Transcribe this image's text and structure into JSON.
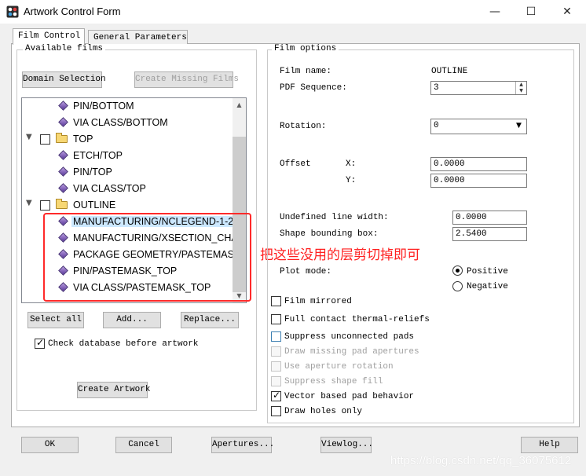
{
  "window": {
    "title": "Artwork Control Form",
    "minimize": "—",
    "maximize": "☐",
    "close": "✕"
  },
  "tabs": [
    {
      "label": "Film Control"
    },
    {
      "label": "General Parameters"
    }
  ],
  "available_films": {
    "label": "Available films",
    "domain_selection": "Domain Selection",
    "create_missing": "Create Missing Films",
    "tree": [
      {
        "label": "PIN/BOTTOM"
      },
      {
        "label": "VIA CLASS/BOTTOM"
      },
      {
        "label": "TOP"
      },
      {
        "label": "ETCH/TOP"
      },
      {
        "label": "PIN/TOP"
      },
      {
        "label": "VIA CLASS/TOP"
      },
      {
        "label": "OUTLINE"
      },
      {
        "label": "MANUFACTURING/NCLEGEND-1-2"
      },
      {
        "label": "MANUFACTURING/XSECTION_CHA"
      },
      {
        "label": "PACKAGE GEOMETRY/PASTEMASK"
      },
      {
        "label": "PIN/PASTEMASK_TOP"
      },
      {
        "label": "VIA CLASS/PASTEMASK_TOP"
      }
    ],
    "select_all": "Select all",
    "add": "Add...",
    "replace": "Replace...",
    "check_database": "Check database before artwork",
    "create_artwork": "Create Artwork"
  },
  "annotation": "把这些没用的层剪切掉即可",
  "film_options": {
    "label": "Film options",
    "film_name_label": "Film name:",
    "film_name_value": "OUTLINE",
    "pdf_sequence_label": "PDF Sequence:",
    "pdf_sequence_value": "3",
    "rotation_label": "Rotation:",
    "rotation_value": "0",
    "offset_label": "Offset",
    "x_label": "X:",
    "x_value": "0.0000",
    "y_label": "Y:",
    "y_value": "0.0000",
    "undefined_line_width_label": "Undefined line width:",
    "undefined_line_width_value": "0.0000",
    "shape_bounding_box_label": "Shape bounding box:",
    "shape_bounding_box_value": "2.5400",
    "plot_mode_label": "Plot mode:",
    "positive": "Positive",
    "negative": "Negative",
    "film_mirrored": "Film mirrored",
    "full_contact": "Full contact thermal-reliefs",
    "suppress_unconnected": "Suppress unconnected pads",
    "draw_missing": "Draw missing pad apertures",
    "use_aperture_rotation": "Use aperture rotation",
    "suppress_shape_fill": "Suppress shape fill",
    "vector_based": "Vector based pad behavior",
    "draw_holes": "Draw holes only"
  },
  "bottom_buttons": {
    "ok": "OK",
    "cancel": "Cancel",
    "apertures": "Apertures...",
    "viewlog": "Viewlog...",
    "help": "Help"
  },
  "watermark": "https://blog.csdn.net/qq_36075612"
}
